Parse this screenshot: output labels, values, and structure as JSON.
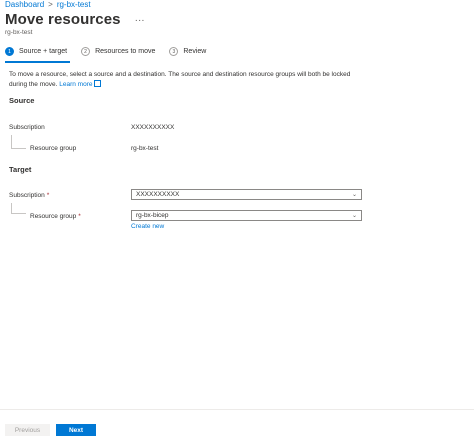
{
  "breadcrumb": {
    "items": [
      "Dashboard",
      "rg-bx-test"
    ],
    "separator": ">"
  },
  "header": {
    "title": "Move resources",
    "more": "···",
    "subtitle": "rg-bx-test"
  },
  "steps": [
    {
      "number": "1",
      "label": "Source + target",
      "active": true
    },
    {
      "number": "2",
      "label": "Resources to move",
      "active": false
    },
    {
      "number": "3",
      "label": "Review",
      "active": false
    }
  ],
  "intro": {
    "text": "To move a resource, select a source and a destination. The source and destination resource groups will both be locked during the move.",
    "learn_more": "Learn more"
  },
  "source": {
    "heading": "Source",
    "subscription_label": "Subscription",
    "subscription_value": "XXXXXXXXXX",
    "resource_group_label": "Resource group",
    "resource_group_value": "rg-bx-test"
  },
  "target": {
    "heading": "Target",
    "subscription_label": "Subscription",
    "subscription_value": "XXXXXXXXXX",
    "resource_group_label": "Resource group",
    "resource_group_value": "rg-bx-bicep",
    "required_mark": "*",
    "create_new": "Create new"
  },
  "footer": {
    "previous": "Previous",
    "next": "Next"
  },
  "colors": {
    "accent": "#0078d4",
    "required": "#a4262c",
    "text": "#323130"
  },
  "icons": {
    "dropdown": "chevron-down-icon",
    "external_link": "external-link-icon"
  }
}
